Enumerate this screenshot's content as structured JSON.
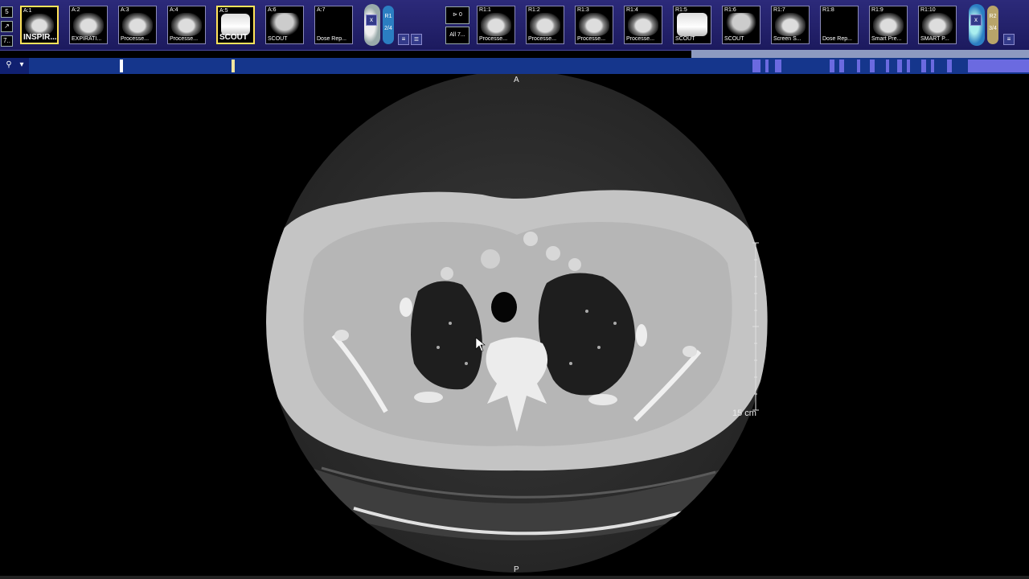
{
  "leftcol": {
    "buttons": [
      "5",
      "↗",
      "7.."
    ]
  },
  "thumbs_a": [
    {
      "top": "A:1",
      "bottom": "INSPIR...",
      "art": "ct",
      "selected": true,
      "big": true
    },
    {
      "top": "A:2",
      "bottom": "EXPIRATI...",
      "art": "ct2"
    },
    {
      "top": "A:3",
      "bottom": "Processe...",
      "art": "ct"
    },
    {
      "top": "A:4",
      "bottom": "Processe...",
      "art": "ct"
    },
    {
      "top": "A:5",
      "bottom": "SCOUT",
      "art": "scout",
      "selected": true,
      "big": true
    },
    {
      "top": "A:6",
      "bottom": "SCOUT",
      "art": "scout2"
    },
    {
      "top": "A:7",
      "bottom": "Dose Rep...",
      "art": "none"
    }
  ],
  "divider_left": {
    "close": "x",
    "label_top": "R1",
    "label_bottom": "2/4"
  },
  "mid_buttons": [
    "0",
    "All 7..."
  ],
  "thumbs_r": [
    {
      "top": "R1:1",
      "bottom": "Processe...",
      "art": "ct"
    },
    {
      "top": "R1:2",
      "bottom": "Processe...",
      "art": "ct"
    },
    {
      "top": "R1:3",
      "bottom": "Processe...",
      "art": "ct"
    },
    {
      "top": "R1:4",
      "bottom": "Processe...",
      "art": "ct"
    },
    {
      "top": "R1:5",
      "bottom": "SCOUT",
      "art": "scout"
    },
    {
      "top": "R1:6",
      "bottom": "SCOUT",
      "art": "scout2"
    },
    {
      "top": "R1:7",
      "bottom": "Screen S...",
      "art": "ct2"
    },
    {
      "top": "R1:8",
      "bottom": "Dose Rep...",
      "art": "none"
    },
    {
      "top": "R1:9",
      "bottom": "Smart Pre...",
      "art": "ct2"
    },
    {
      "top": "R1:10",
      "bottom": "SMART P...",
      "art": "ct2"
    }
  ],
  "divider_right": {
    "close": "x",
    "label_top": "R2",
    "label_bottom": "3/4"
  },
  "viewport": {
    "orientation_top": "A",
    "orientation_bottom": "P",
    "scale_label": "15 cm"
  },
  "colors": {
    "toolbar": "#2c2a7a",
    "highlight": "#ffe35a",
    "series_track": "#15368c",
    "series_marker": "#6b6ae0"
  }
}
